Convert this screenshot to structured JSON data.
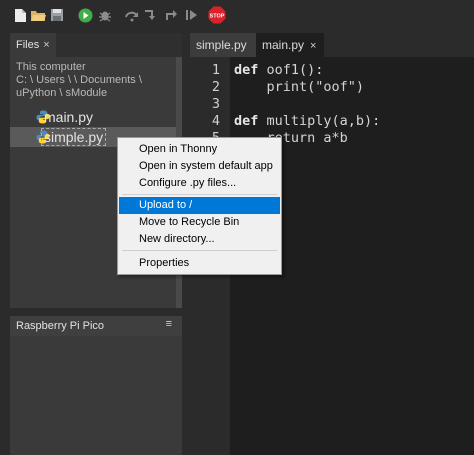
{
  "toolbar": {
    "icons": [
      "new-file-icon",
      "open-folder-icon",
      "save-icon",
      "run-icon",
      "debug-icon",
      "step-over-icon",
      "step-into-icon",
      "step-out-icon",
      "resume-icon",
      "stop-icon"
    ],
    "stop_label": "STOP"
  },
  "files": {
    "tab_label": "Files",
    "tab_close": "×",
    "path_lines": [
      "This computer",
      "C: \\ Users \\         \\ Documents \\",
      "uPython \\ sModule"
    ],
    "items": [
      {
        "name": "main.py",
        "selected": false
      },
      {
        "name": "simple.py",
        "selected": true
      }
    ],
    "menu_glyph": "≡"
  },
  "pico": {
    "title": "Raspberry Pi Pico",
    "menu_glyph": "≡"
  },
  "editor": {
    "tabs": [
      {
        "label": "simple.py",
        "active": false
      },
      {
        "label": "main.py",
        "active": true
      }
    ],
    "tab_close": "×",
    "line_numbers": [
      "1",
      "2",
      "3",
      "4",
      "5"
    ],
    "lines": [
      {
        "kw": "def",
        "rest": " oof1():"
      },
      {
        "kw": "",
        "rest": "    print(\"oof\")"
      },
      {
        "kw": "",
        "rest": ""
      },
      {
        "kw": "def",
        "rest": " multiply(a,b):"
      },
      {
        "kw": "",
        "rest": "    return a*b"
      }
    ]
  },
  "context_menu": {
    "items": [
      "Open in Thonny",
      "Open in system default app",
      "Configure .py files...",
      "Upload to /",
      "Move to Recycle Bin",
      "New directory...",
      "Properties"
    ],
    "highlighted": "Upload to /"
  },
  "colors": {
    "highlight": "#0078d7",
    "stop": "#d9222a",
    "run": "#3fae49"
  }
}
